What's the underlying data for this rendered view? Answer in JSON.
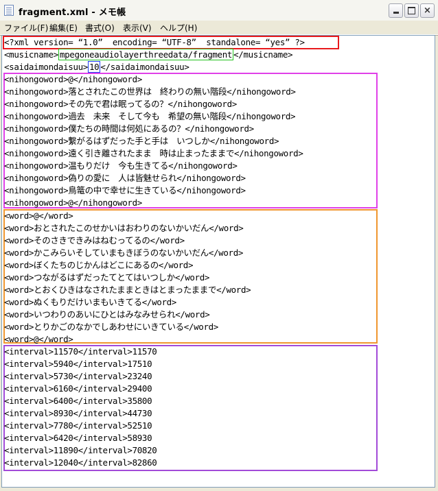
{
  "window": {
    "title": "fragment.xml - メモ帳"
  },
  "menu": {
    "file": "ファイル(F)",
    "edit": "編集(E)",
    "format": "書式(O)",
    "view": "表示(V)",
    "help": "ヘルプ(H)"
  },
  "header": {
    "xml_declaration": "<?xml version= “1.0”  encoding= “UTF-8”  standalone= “yes” ?>",
    "musicname_open": "<musicname>",
    "musicname_value": "mpegoneaudiolayerthreedata/fragment",
    "musicname_close": "</musicname>",
    "saidai_open": "<saidaimondaisuu>",
    "saidai_value": "10",
    "saidai_close": "</saidaimondaisuu>"
  },
  "nihongowords": [
    "<nihongoword>@</nihongoword>",
    "<nihongoword>落とされたこの世界は　終わりの無い階段</nihongoword>",
    "<nihongoword>その先で君は眠ってるの？</nihongoword>",
    "<nihongoword>過去　未来　そして今も　希望の無い階段</nihongoword>",
    "<nihongoword>僕たちの時間は何処にあるの？</nihongoword>",
    "<nihongoword>繋がるはずだった手と手は　いつしか</nihongoword>",
    "<nihongoword>遠く引き離されたまま　時は止まったままで</nihongoword>",
    "<nihongoword>温もりだけ　今も生きてる</nihongoword>",
    "<nihongoword>偽りの愛に　人は皆魅せられ</nihongoword>",
    "<nihongoword>鳥篭の中で幸せに生きている</nihongoword>",
    "<nihongoword>@</nihongoword>"
  ],
  "words": [
    "<word>@</word>",
    "<word>おとされたこのせかいはおわりのないかいだん</word>",
    "<word>そのさきできみはねむってるの</word>",
    "<word>かこみらいそしていまもきぼうのないかいだん</word>",
    "<word>ぼくたちのじかんはどこにあるの</word>",
    "<word>つながるはずだったてとてはいつしか</word>",
    "<word>とおくひきはなされたままときはとまったままで</word>",
    "<word>ぬくもりだけいまもいきてる</word>",
    "<word>いつわりのあいにひとはみなみせられ</word>",
    "<word>とりかごのなかでしあわせにいきている</word>",
    "<word>@</word>"
  ],
  "intervals": [
    "<interval>11570</interval>11570",
    "<interval>5940</interval>17510",
    "<interval>5730</interval>23240",
    "<interval>6160</interval>29400",
    "<interval>6400</interval>35800",
    "<interval>8930</interval>44730",
    "<interval>7780</interval>52510",
    "<interval>6420</interval>58930",
    "<interval>11890</interval>70820",
    "<interval>12040</interval>82860"
  ],
  "colors": {
    "declaration_box": "#e8191c",
    "musicname_box": "#22c21e",
    "saidai_box": "#1a3cf0",
    "nihongoword_box": "#e040e8",
    "word_box": "#f0962e",
    "interval_box": "#a24ad8"
  }
}
